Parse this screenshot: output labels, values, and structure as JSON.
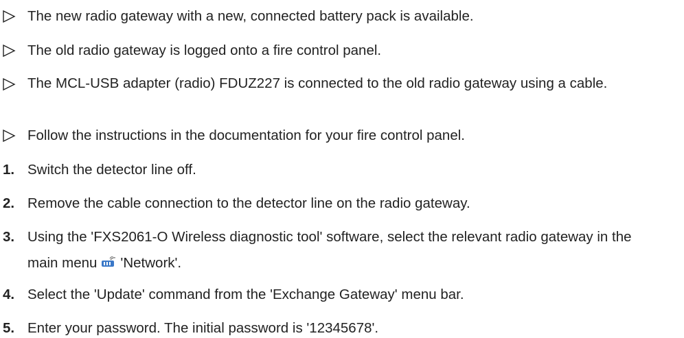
{
  "prerequisites": [
    "The new radio gateway with a new, connected battery pack is available.",
    "The old radio gateway is logged onto a fire control panel.",
    "The MCL-USB adapter (radio) FDUZ227 is connected to the old radio gateway using a cable.",
    "Follow the instructions in the documentation for your fire control panel."
  ],
  "steps": [
    {
      "num": "1.",
      "text": "Switch the detector line off."
    },
    {
      "num": "2.",
      "text": "Remove the cable connection to the detector line on the radio gateway."
    },
    {
      "num": "3.",
      "text_before": "Using the 'FXS2061-O Wireless diagnostic tool' software, select the relevant radio gateway in the main menu",
      "text_after": "'Network'."
    },
    {
      "num": "4.",
      "text": "Select the 'Update' command from the 'Exchange Gateway' menu bar."
    },
    {
      "num": "5.",
      "text": "Enter your password. The initial password is '12345678'."
    }
  ],
  "icons": {
    "prerequisite_marker": "triangle-right-outline-icon",
    "network_menu": "network-icon"
  },
  "colors": {
    "text": "#222222",
    "marker": "#222222",
    "network_icon": "#3a78c8"
  }
}
